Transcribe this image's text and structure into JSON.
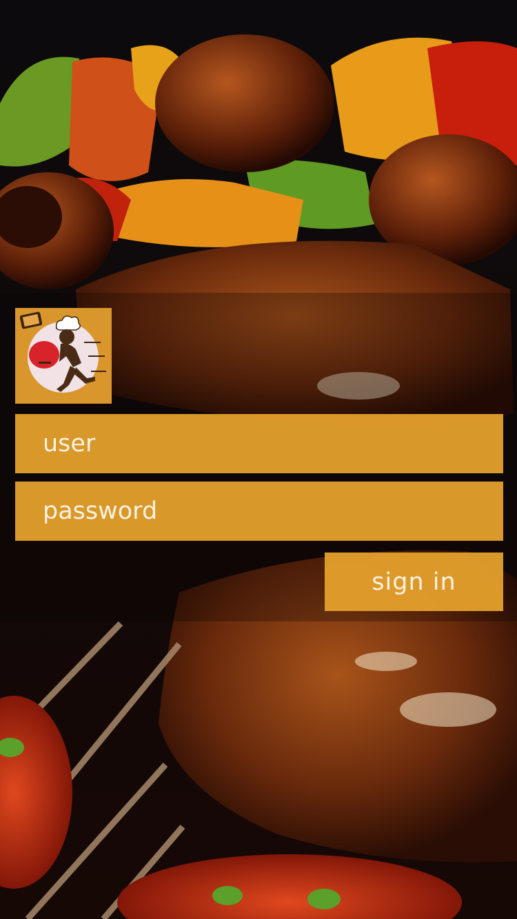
{
  "login": {
    "user_placeholder": "user",
    "password_placeholder": "password",
    "sign_in_label": "sign in"
  },
  "logo": {
    "icon": "delivery-chef-icon"
  },
  "background": {
    "icon": "grilled-food-photo"
  },
  "colors": {
    "accent": "#e5a12d",
    "logo_bg": "#d8962c",
    "text": "#fbf2e2"
  }
}
